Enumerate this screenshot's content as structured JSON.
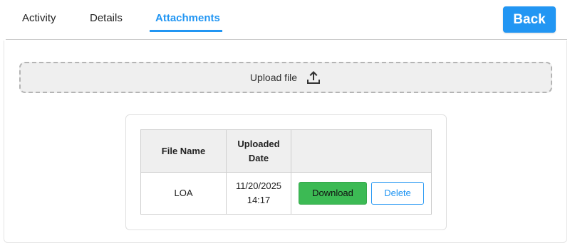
{
  "tabs": [
    {
      "label": "Activity",
      "active": false
    },
    {
      "label": "Details",
      "active": false
    },
    {
      "label": "Attachments",
      "active": true
    }
  ],
  "header": {
    "back_label": "Back"
  },
  "upload": {
    "label": "Upload file",
    "icon": "upload-icon"
  },
  "table": {
    "columns": [
      "File Name",
      "Uploaded Date",
      ""
    ],
    "rows": [
      {
        "file_name": "LOA",
        "uploaded_date": "11/20/2025",
        "uploaded_time": "14:17",
        "download_label": "Download",
        "delete_label": "Delete"
      }
    ]
  },
  "colors": {
    "accent": "#2296f3",
    "download": "#3cba54",
    "upload_bg": "#efefef"
  }
}
